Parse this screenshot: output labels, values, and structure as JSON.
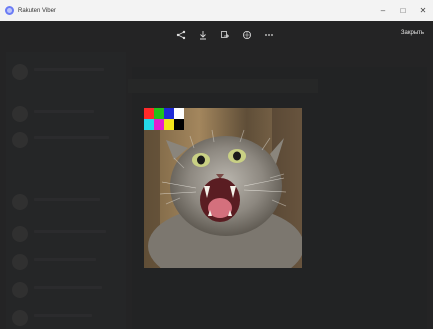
{
  "window": {
    "title": "Rakuten Viber",
    "minimize": "–",
    "maximize": "□",
    "close": "✕"
  },
  "toolbar": {
    "icons": [
      "share-icon",
      "download-icon",
      "forward-icon",
      "globe-icon",
      "more-icon"
    ],
    "close_label": "Закрыть"
  },
  "media": {
    "test_pattern_colors": [
      "#ff2a2a",
      "#22c21a",
      "#1e2bd6",
      "#ffffff",
      "#24d8e8",
      "#e51ecf",
      "#f2e41b",
      "#000000"
    ]
  }
}
